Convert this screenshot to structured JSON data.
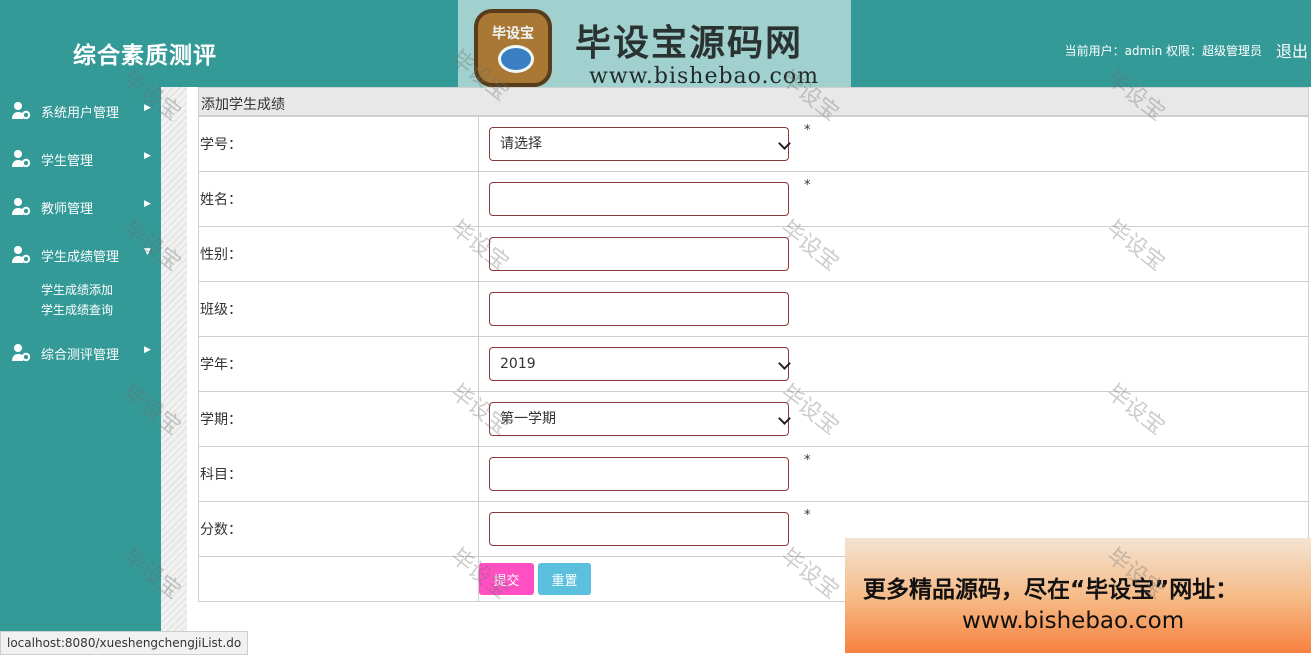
{
  "header": {
    "app_title": "综合素质测评",
    "user_info": "当前用户：admin  权限：超级管理员",
    "logout": "退出"
  },
  "banner": {
    "badge_text": "毕设宝",
    "title": "毕设宝源码网",
    "url": "www.bishebao.com"
  },
  "sidebar": {
    "items": [
      {
        "label": "系统用户管理",
        "arrow": "▶"
      },
      {
        "label": "学生管理",
        "arrow": "▶"
      },
      {
        "label": "教师管理",
        "arrow": "▶"
      },
      {
        "label": "学生成绩管理",
        "arrow": "▼"
      },
      {
        "label": "综合测评管理",
        "arrow": "▶"
      }
    ],
    "submenu": [
      {
        "label": "学生成绩添加"
      },
      {
        "label": "学生成绩查询"
      }
    ]
  },
  "panel": {
    "title": "添加学生成绩"
  },
  "form": {
    "student_id": {
      "label": "学号：",
      "value": "请选择",
      "required": "*"
    },
    "name": {
      "label": "姓名：",
      "value": "",
      "required": "*"
    },
    "gender": {
      "label": "性别：",
      "value": ""
    },
    "class": {
      "label": "班级：",
      "value": ""
    },
    "school_year": {
      "label": "学年：",
      "value": "2019"
    },
    "semester": {
      "label": "学期：",
      "value": "第一学期"
    },
    "subject": {
      "label": "科目：",
      "value": "",
      "required": "*"
    },
    "score": {
      "label": "分数：",
      "value": "",
      "required": "*"
    },
    "submit_label": "提交",
    "reset_label": "重置"
  },
  "ad": {
    "line1": "更多精品源码，尽在“毕设宝”网址：",
    "line2": "www.bishebao.com"
  },
  "status_url": "localhost:8080/xueshengchengjiList.do",
  "watermark": "毕设宝",
  "colors": {
    "primary": "#339a98",
    "submit": "#ff4fc2",
    "reset": "#5bc0de",
    "input_border": "#8b3a3a"
  }
}
